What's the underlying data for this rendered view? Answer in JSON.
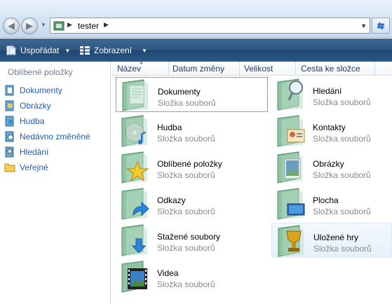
{
  "address": {
    "path": "tester"
  },
  "toolbar": {
    "organize_label": "Uspořádat",
    "views_label": "Zobrazení"
  },
  "navpane": {
    "header": "Oblíbené položky",
    "items": [
      {
        "label": "Dokumenty",
        "icon": "documents-icon"
      },
      {
        "label": "Obrázky",
        "icon": "pictures-icon"
      },
      {
        "label": "Hudba",
        "icon": "music-icon"
      },
      {
        "label": "Nedávno změněné",
        "icon": "recent-icon"
      },
      {
        "label": "Hledání",
        "icon": "search-icon"
      },
      {
        "label": "Veřejné",
        "icon": "public-folder-icon"
      }
    ]
  },
  "columns": [
    "Název",
    "Datum změny",
    "Velikost",
    "Cesta ke složce"
  ],
  "folders": [
    {
      "name": "Dokumenty",
      "type": "Složka souborů",
      "icon": "documents-folder-icon"
    },
    {
      "name": "Hledání",
      "type": "Složka souborů",
      "icon": "search-folder-icon"
    },
    {
      "name": "Hudba",
      "type": "Složka souborů",
      "icon": "music-folder-icon"
    },
    {
      "name": "Kontakty",
      "type": "Složka souborů",
      "icon": "contacts-folder-icon"
    },
    {
      "name": "Oblíbené položky",
      "type": "Složka souborů",
      "icon": "favorites-folder-icon"
    },
    {
      "name": "Obrázky",
      "type": "Složka souborů",
      "icon": "pictures-folder-icon"
    },
    {
      "name": "Odkazy",
      "type": "Složka souborů",
      "icon": "links-folder-icon"
    },
    {
      "name": "Plocha",
      "type": "Složka souborů",
      "icon": "desktop-folder-icon"
    },
    {
      "name": "Stažené soubory",
      "type": "Složka souborů",
      "icon": "downloads-folder-icon"
    },
    {
      "name": "Uložené hry",
      "type": "Složka souborů",
      "icon": "saved-games-folder-icon"
    },
    {
      "name": "Videa",
      "type": "Složka souborů",
      "icon": "videos-folder-icon"
    }
  ]
}
